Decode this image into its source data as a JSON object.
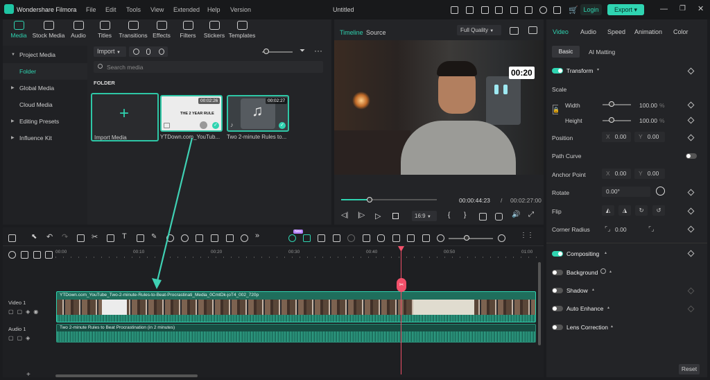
{
  "app": {
    "name": "Wondershare Filmora",
    "menu": [
      "File",
      "Edit",
      "Tools",
      "View",
      "Extended",
      "Help",
      "Version"
    ],
    "doc_title": "Untitled",
    "login": "Login",
    "export": "Export"
  },
  "media_tabs": [
    "Media",
    "Stock Media",
    "Audio",
    "Titles",
    "Transitions",
    "Effects",
    "Filters",
    "Stickers",
    "Templates"
  ],
  "sidebar": {
    "items": [
      {
        "label": "Project Media"
      },
      {
        "label": "Folder"
      },
      {
        "label": "Global Media"
      },
      {
        "label": "Cloud Media"
      },
      {
        "label": "Editing Presets"
      },
      {
        "label": "Influence Kit"
      }
    ]
  },
  "library": {
    "import_label": "Import",
    "search_placeholder": "Search media",
    "folder_heading": "FOLDER",
    "import_media_label": "Import Media",
    "items": [
      {
        "name": "YTDown.com_YouTub...",
        "duration": "00:02:26",
        "thumb_text": "THE 2 YEAR RULE"
      },
      {
        "name": "Two 2-minute Rules to...",
        "duration": "00:02:27"
      }
    ]
  },
  "player": {
    "tabs": [
      "Timeline",
      "Source"
    ],
    "quality": "Full Quality",
    "overlay_time": "00:20",
    "current_time": "00:00:44:23",
    "separator": "/",
    "total_time": "00:02:27:00",
    "aspect": "16:9",
    "progress": 0.3
  },
  "props": {
    "tabs": [
      "Video",
      "Audio",
      "Speed",
      "Animation",
      "Color"
    ],
    "subtabs": [
      "Basic",
      "AI Matting"
    ],
    "transform": "Transform",
    "scale": "Scale",
    "width_label": "Width",
    "width_value": "100.00",
    "height_label": "Height",
    "height_value": "100.00",
    "percent": "%",
    "position": "Position",
    "x_label": "X",
    "y_label": "Y",
    "pos_x": "0.00",
    "pos_y": "0.00",
    "path_curve": "Path Curve",
    "anchor_point": "Anchor Point",
    "anchor_x": "0.00",
    "anchor_y": "0.00",
    "rotate": "Rotate",
    "rotate_value": "0.00°",
    "flip": "Flip",
    "corner_radius": "Corner Radius",
    "corner_value": "0.00",
    "compositing": "Compositing",
    "background": "Background",
    "shadow": "Shadow",
    "auto_enhance": "Auto Enhance",
    "lens_correction": "Lens Correction",
    "reset": "Reset"
  },
  "timeline": {
    "ruler": [
      "00:00",
      "00:10",
      "00:20",
      "00:30",
      "00:40",
      "00:50",
      "01:00"
    ],
    "video_track_label": "Video 1",
    "audio_track_label": "Audio 1",
    "video_clip": "YTDown.com_YouTube_Two-2-minute-Rules-to-Beat-Procrastinati_Media_0CmtDk-joT4_002_720p",
    "audio_clip": "Two 2-minute Rules to Beat Procrastination (in 2 minutes)",
    "new_badge": "New"
  },
  "colors": {
    "accent": "#2fd4b1",
    "playhead": "#f2506a",
    "bg": "#1b1c1f",
    "panel": "#232427"
  }
}
